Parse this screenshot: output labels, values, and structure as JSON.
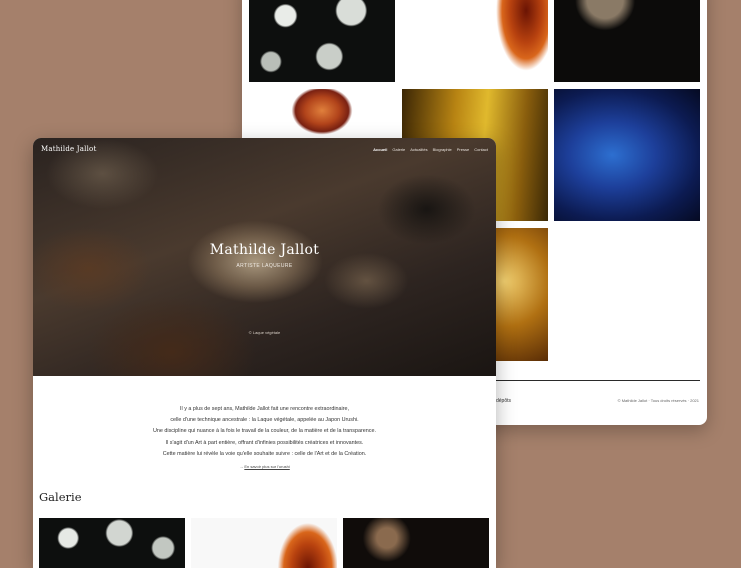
{
  "back_page": {
    "footer_link": "dépôts",
    "copyright": "© Mathilde Jallot · Tous droits réservés · 2021"
  },
  "site": {
    "brand": "Mathilde Jallot",
    "nav": [
      "Accueil",
      "Galerie",
      "Actualités",
      "Biographie",
      "Presse",
      "Contact"
    ],
    "hero_title": "Mathilde Jallot",
    "hero_subtitle": "ARTISTE LAQUEURE",
    "hero_credit": "© Laque végétale",
    "intro": [
      "Il y a plus de sept ans, Mathilde Jallot fait une rencontre extraordinaire,",
      "celle d'une technique ancestrale : la Laque végétale, appelée au Japon Urushi.",
      "Une discipline qui nuance à la fois le travail de la couleur, de la matière et de la transparence.",
      "Il s'agit d'un Art à part entière, offrant d'infinies possibilités créatrices et innovantes.",
      "Cette matière lui révèle la voie qu'elle souhaite suivre : celle de l'Art et de la Création."
    ],
    "more_prefix": "→",
    "more_link": "En savoir plus sur l'urushi",
    "gallery_title": "Galerie"
  }
}
